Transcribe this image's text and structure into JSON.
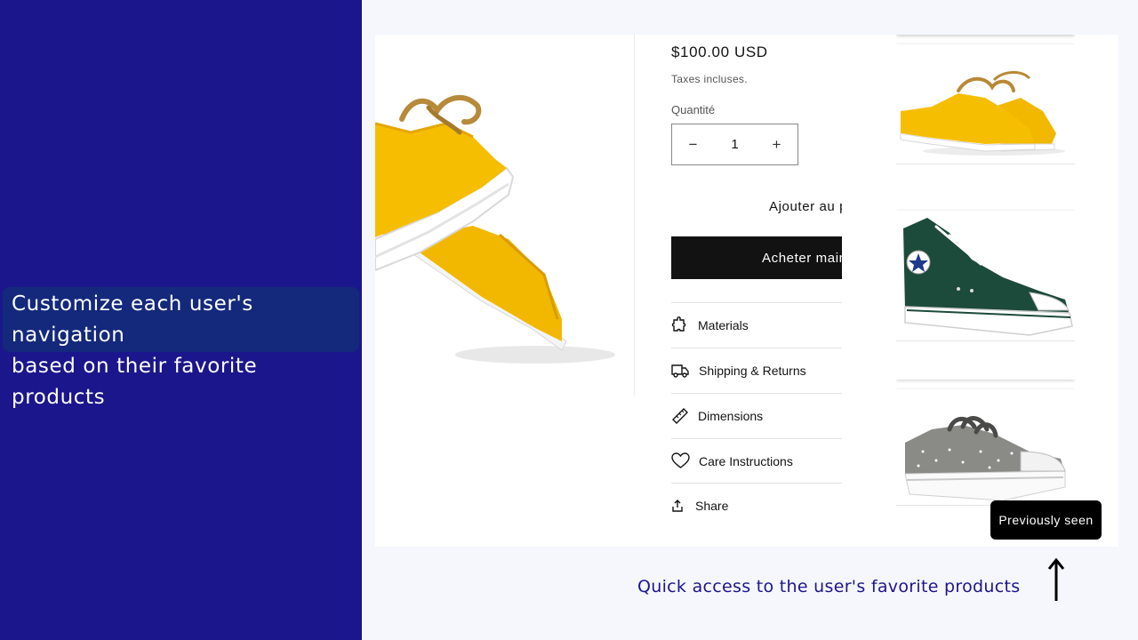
{
  "left_panel": {
    "callout_line1": "Customize each user's navigation",
    "callout_line2": "based on their favorite products"
  },
  "product": {
    "price": "$100.00 USD",
    "taxes": "Taxes incluses.",
    "quantity_label": "Quantité",
    "quantity_value": "1",
    "decrement_symbol": "−",
    "increment_symbol": "+",
    "add_to_cart": "Ajouter au panier",
    "buy_now": "Acheter maintenant",
    "accordions": [
      {
        "label": "Materials",
        "icon": "puzzle-icon"
      },
      {
        "label": "Shipping & Returns",
        "icon": "truck-icon"
      },
      {
        "label": "Dimensions",
        "icon": "ruler-icon"
      },
      {
        "label": "Care Instructions",
        "icon": "heart-icon"
      }
    ],
    "share": "Share"
  },
  "sidebar": {
    "button": "Previously seen",
    "items": [
      {
        "name": "yellow-sneaker",
        "icon": "yellow-sneaker-image"
      },
      {
        "name": "green-high-top",
        "icon": "green-hightop-image"
      },
      {
        "name": "grey-star-sneaker",
        "icon": "grey-sneaker-image"
      }
    ]
  },
  "caption": "Quick access to the user's favorite products",
  "colors": {
    "left_panel": "#1c168c",
    "callout_bg": "#14297b",
    "caption": "#1c168c",
    "sneaker_yellow": "#f2b800",
    "buy_button": "#121212"
  }
}
